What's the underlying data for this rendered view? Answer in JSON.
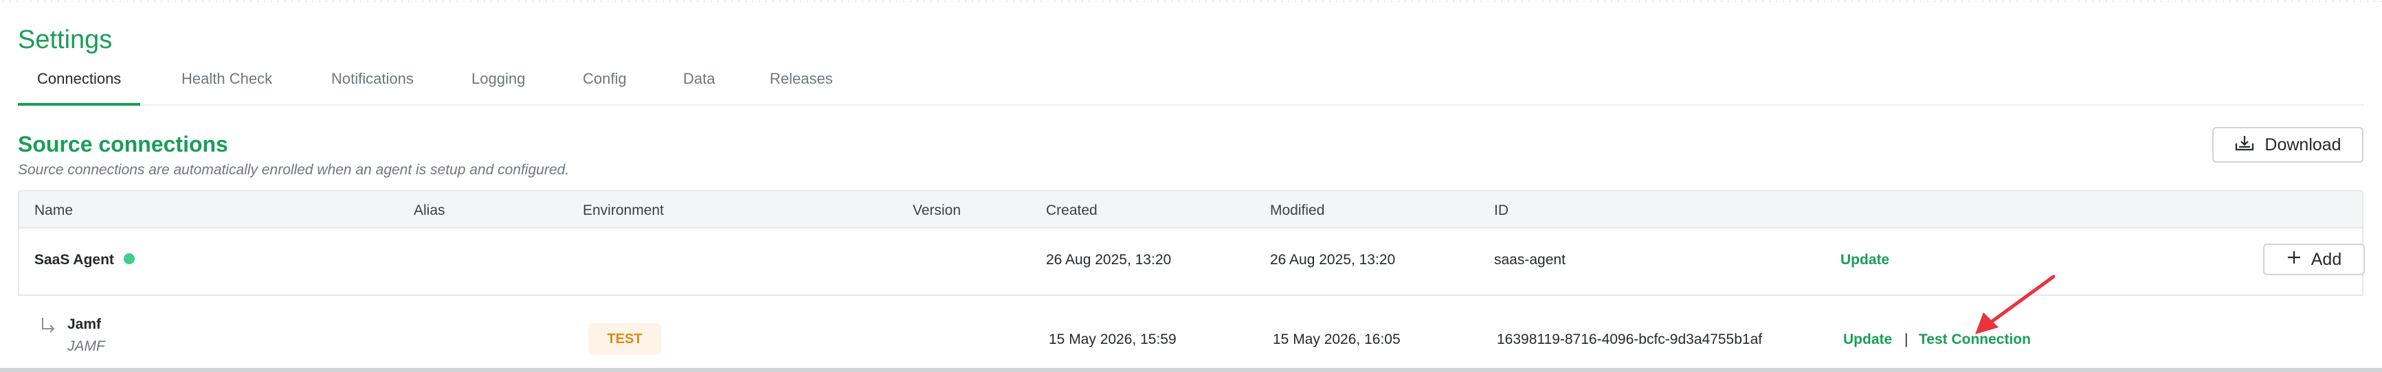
{
  "page": {
    "title": "Settings"
  },
  "tabs": [
    {
      "label": "Connections",
      "active": true
    },
    {
      "label": "Health Check",
      "active": false
    },
    {
      "label": "Notifications",
      "active": false
    },
    {
      "label": "Logging",
      "active": false
    },
    {
      "label": "Config",
      "active": false
    },
    {
      "label": "Data",
      "active": false
    },
    {
      "label": "Releases",
      "active": false
    }
  ],
  "section": {
    "title": "Source connections",
    "subtitle": "Source connections are automatically enrolled when an agent is setup and configured.",
    "download_label": "Download"
  },
  "table": {
    "columns": [
      "Name",
      "Alias",
      "Environment",
      "Version",
      "Created",
      "Modified",
      "ID"
    ],
    "rows": [
      {
        "name": "SaaS Agent",
        "status": "connected",
        "status_color": "#3ccf8e",
        "alias": "",
        "environment": "",
        "version": "",
        "created": "26 Aug 2025, 13:20",
        "modified": "26 Aug 2025, 13:20",
        "id": "saas-agent",
        "update_label": "Update",
        "add_label": "Add"
      },
      {
        "name": "Jamf",
        "subname": "JAMF",
        "child_icon": "subdirectory-arrow-icon",
        "environment": "TEST",
        "created": "15 May 2026, 15:59",
        "modified": "15 May 2026, 16:05",
        "id": "16398119-8716-4096-bcfc-9d3a4755b1af",
        "update_label": "Update",
        "separator": "|",
        "test_label": "Test Connection"
      }
    ]
  },
  "annotation": {
    "type": "red-arrow",
    "color": "#e8343a",
    "target": "Test Connection"
  },
  "colors": {
    "accent": "#1a9d5a",
    "badge_text": "#d98a1a",
    "badge_bg": "#fdf4e7"
  }
}
